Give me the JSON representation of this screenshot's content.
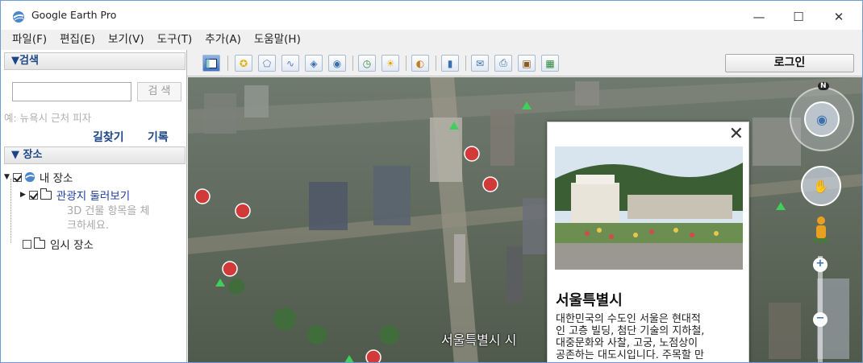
{
  "window": {
    "title": "Google Earth Pro",
    "minimize": "—",
    "maximize": "☐",
    "close": "✕"
  },
  "menu": [
    "파일(F)",
    "편집(E)",
    "보기(V)",
    "도구(T)",
    "추가(A)",
    "도움말(H)"
  ],
  "search": {
    "header": "▼검색",
    "input_value": "",
    "button": "검 색",
    "hint": "예: 뉴욕시 근처 피자",
    "link_directions": "길찾기",
    "link_history": "기록"
  },
  "places": {
    "header": "▼ 장소",
    "my_places": "내 장소",
    "tour": "관광지 둘러보기",
    "tour_hint_1": "3D 건물 항목을 체",
    "tour_hint_2": "크하세요.",
    "temp_places": "임시 장소"
  },
  "toolbar": {
    "login": "로그인",
    "icons": [
      "sidebar-toggle-icon",
      "placemark-icon",
      "polygon-icon",
      "path-icon",
      "image-overlay-icon",
      "record-tour-icon",
      "historical-imagery-icon",
      "sunlight-icon",
      "planets-icon",
      "ruler-icon",
      "email-icon",
      "print-icon",
      "save-image-icon",
      "maps-icon"
    ]
  },
  "map": {
    "place_label": "서울특별시 시",
    "compass_letter": "N",
    "zoom_plus": "+",
    "zoom_minus": "−"
  },
  "popup": {
    "close": "✕",
    "title": "서울특별시",
    "body": "대한민국의 수도인 서울은 현대적\n인 고층 빌딩, 첨단 기술의 지하철,\n대중문화와 사찰, 고궁, 노점상이\n공존하는 대도시입니다. 주목할 만"
  }
}
